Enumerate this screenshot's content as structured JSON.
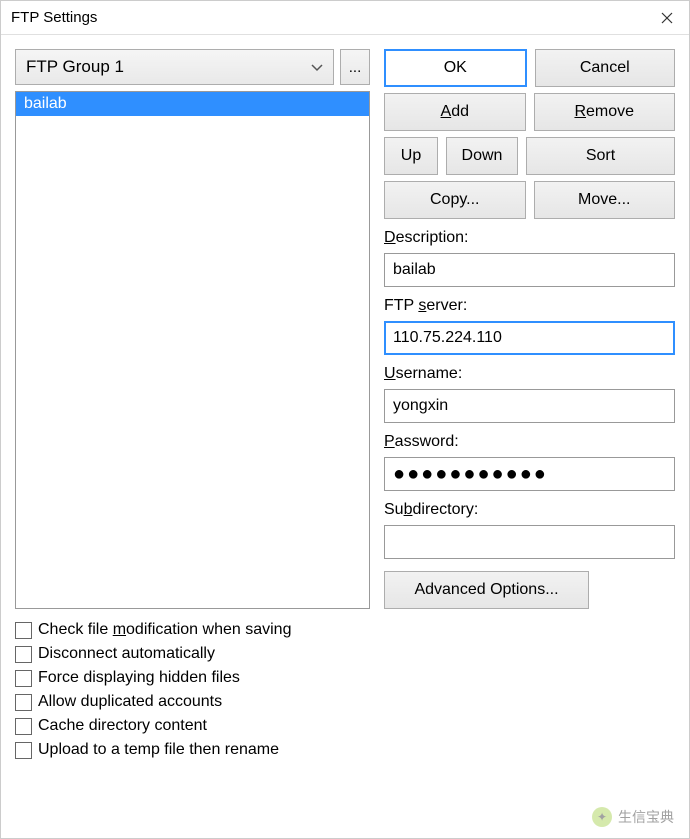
{
  "window": {
    "title": "FTP Settings"
  },
  "group": {
    "selected": "FTP Group 1",
    "ellipsis": "..."
  },
  "list": {
    "items": [
      "bailab"
    ]
  },
  "buttons": {
    "ok": "OK",
    "cancel": "Cancel",
    "add_prefix": "",
    "add_ul": "A",
    "add_suffix": "dd",
    "remove_prefix": "",
    "remove_ul": "R",
    "remove_suffix": "emove",
    "up": "Up",
    "down": "Down",
    "sort": "Sort",
    "copy": "Copy...",
    "move": "Move...",
    "advanced": "Advanced Options..."
  },
  "labels": {
    "description_ul": "D",
    "description_rest": "escription:",
    "server_prefix": "FTP ",
    "server_ul": "s",
    "server_suffix": "erver:",
    "username_ul": "U",
    "username_rest": "sername:",
    "password_ul": "P",
    "password_rest": "assword:",
    "subdir_prefix": "Su",
    "subdir_ul": "b",
    "subdir_suffix": "directory:"
  },
  "fields": {
    "description": "bailab",
    "server": "110.75.224.110",
    "username": "yongxin",
    "password_mask": "●●●●●●●●●●●",
    "subdirectory": ""
  },
  "checks": {
    "c1_prefix": "Check file ",
    "c1_ul": "m",
    "c1_suffix": "odification when saving",
    "c2": "Disconnect automatically",
    "c3": "Force displaying hidden files",
    "c4": "Allow duplicated accounts",
    "c5": "Cache directory content",
    "c6": "Upload to a temp file then rename"
  },
  "watermark": {
    "text": "生信宝典"
  }
}
